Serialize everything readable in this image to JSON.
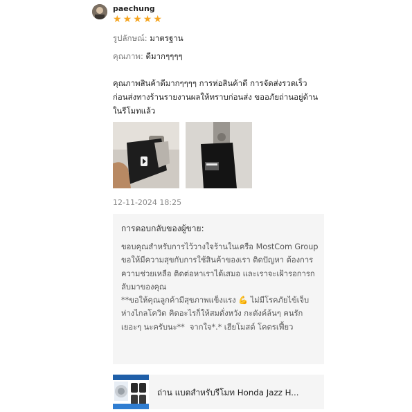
{
  "review": {
    "username": "paechung",
    "rating": 5,
    "stars": [
      "★",
      "★",
      "★",
      "★",
      "★"
    ],
    "star_color": "#f5a623",
    "appearance_label": "รูปลักษณ์:",
    "appearance_value": "มาตรฐาน",
    "quality_label": "คุณภาพ:",
    "quality_value": "ดีมากๆๆๆๆ",
    "text": "คุณภาพสินค้าดีมากๆๆๆๆ การห่อสินค้าดี การจัดส่งรวดเร็ว ก่อนส่งทางร้านรายงานผลให้ทราบก่อนส่ง ขออภัยถ่านอยู่ด้านในรีโมทแล้ว",
    "photos": [
      {
        "name": "review-photo-1",
        "desc": "car-key-remote"
      },
      {
        "name": "review-photo-2",
        "desc": "car-key-remote-closeup"
      }
    ],
    "timestamp": "12-11-2024 18:25"
  },
  "seller_reply": {
    "title": "การตอบกลับของผู้ขาย:",
    "body": "ขอบคุณสำหรับการไว้วางใจร้านในเครือ MostCom Group ขอให้มีความสุขกับการใช้สินค้าของเรา ติดปัญหา ต้องการความช่วยเหลือ ติดต่อหาเราได้เสมอ และเราจะเฝ้ารอการกลับมาของคุณ\n**ขอให้คุณลูกค้ามีสุขภาพแข็งแรง 💪 ไม่มีโรคภัยไข้เจ็บ ห่างไกลโควิด คิดอะไรก็ให้สมดั่งหวัง กะตังค์ล้นๆ คนรักเยอะๆ นะครับนะ**  จากใจ*.* เฮียโมสต์ โคตรเฟี้ยว"
  },
  "product": {
    "title": "ถ่าน แบตสำหรับรีโมท Honda Jazz H...",
    "icon": "battery-product-thumbnail"
  }
}
